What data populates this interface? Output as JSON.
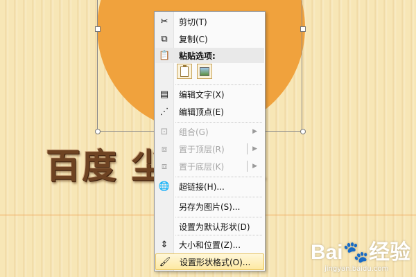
{
  "wordart": {
    "text": "百度 尘2011"
  },
  "watermark": {
    "logo_left": "Bai",
    "logo_paw": "🐾",
    "logo_right": "经验",
    "subtitle": "jingyan.baidu.com"
  },
  "menu": {
    "items": [
      {
        "label": "剪切(T)",
        "icon": "scissors-icon"
      },
      {
        "label": "复制(C)",
        "icon": "copy-icon"
      },
      {
        "label": "粘贴选项:",
        "icon": "paste-icon"
      },
      {
        "label": "编辑文字(X)",
        "icon": "edit-text-icon"
      },
      {
        "label": "编辑顶点(E)",
        "icon": "edit-points-icon"
      },
      {
        "label": "组合(G)",
        "icon": "group-icon",
        "disabled": true
      },
      {
        "label": "置于顶层(R)",
        "icon": "bring-to-front-icon",
        "disabled": true
      },
      {
        "label": "置于底层(K)",
        "icon": "send-to-back-icon",
        "disabled": true
      },
      {
        "label": "超链接(H)...",
        "icon": "hyperlink-icon"
      },
      {
        "label": "另存为图片(S)...",
        "icon": ""
      },
      {
        "label": "设置为默认形状(D)",
        "icon": ""
      },
      {
        "label": "大小和位置(Z)...",
        "icon": "size-position-icon"
      },
      {
        "label": "设置形状格式(O)...",
        "icon": "format-shape-icon",
        "highlighted": true
      }
    ]
  }
}
